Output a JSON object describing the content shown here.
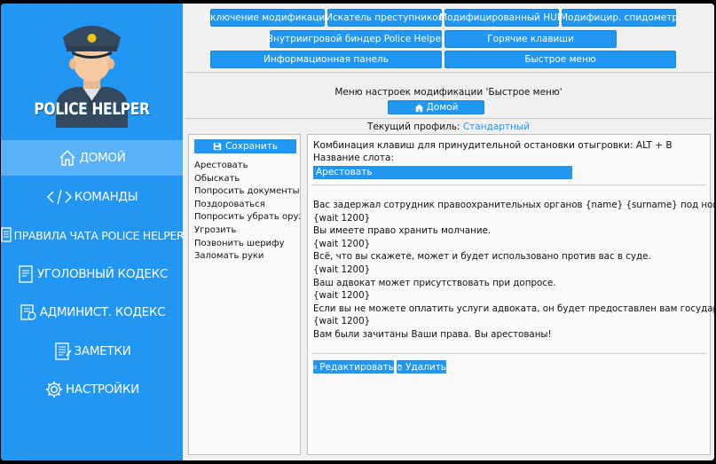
{
  "app": {
    "logo_text": "POLICE HELPER"
  },
  "sidebar": {
    "items": [
      {
        "label": "ДОМОЙ",
        "icon": "home-icon",
        "active": true
      },
      {
        "label": "КОМАНДЫ",
        "icon": "code-icon",
        "active": false
      },
      {
        "label": "ПРАВИЛА ЧАТА POLICE HELPER",
        "icon": "rules-icon",
        "active": false
      },
      {
        "label": "УГОЛОВНЫЙ КОДЕКС",
        "icon": "criminal-code-icon",
        "active": false
      },
      {
        "label": "АДМИНИСТ. КОДЕКС",
        "icon": "admin-code-icon",
        "active": false
      },
      {
        "label": "ЗАМЕТКИ",
        "icon": "notes-icon",
        "active": false
      },
      {
        "label": "НАСТРОЙКИ",
        "icon": "gear-icon",
        "active": false
      }
    ]
  },
  "top_buttons": {
    "mods_enable": "Включение модификаций",
    "criminal_finder": "Искатель преступников",
    "modified_hud": "Модифицированный HUD",
    "modified_speedometer": "Модифицир. спидометр",
    "ingame_binder": "Внутриигровой биндер Police Helper",
    "hotkeys": "Горячие клавиши",
    "info_panel": "Информационная панель",
    "quick_menu": "Быстрое меню"
  },
  "page": {
    "title": "Меню настроек модификации 'Быстрое меню'",
    "home_button": "Домой",
    "profile_label": "Текущий профиль:",
    "profile_value": "Стандартный"
  },
  "left_panel": {
    "save_label": "Сохранить",
    "slots": [
      "Арестовать",
      "Обыскать",
      "Попросить документы",
      "Поздороваться",
      "Попросить убрать оружие",
      "Угрозить",
      "Позвонить шерифу",
      "Заломать руки"
    ]
  },
  "right_panel": {
    "stop_hotkey": "Комбинация клавиш для принудительной остановки отыгровки: ALT + B",
    "slot_name_label": "Название слота:",
    "slot_name_value": "Арестовать",
    "lines": [
      "Вас задержал сотрудник правоохранительных органов {name} {surname} под номером {id}.",
      "{wait 1200}",
      "Вы имеете право хранить молчание.",
      "{wait 1200}",
      "Всё, что вы скажете, может и будет использовано против вас в суде.",
      "{wait 1200}",
      "Ваш адвокат может присутствовать при допросе.",
      "{wait 1200}",
      "Если вы не можете оплатить услуги адвоката, он будет предоставлен вам государством.",
      "{wait 1200}",
      "Вам были зачитаны Ваши права. Вы арестованы!"
    ],
    "edit_label": "Редактировать",
    "delete_label": "Удалить"
  },
  "colors": {
    "accent": "#2196f3",
    "sidebar_active": "#59b1f7",
    "background": "#f0f0f0"
  }
}
